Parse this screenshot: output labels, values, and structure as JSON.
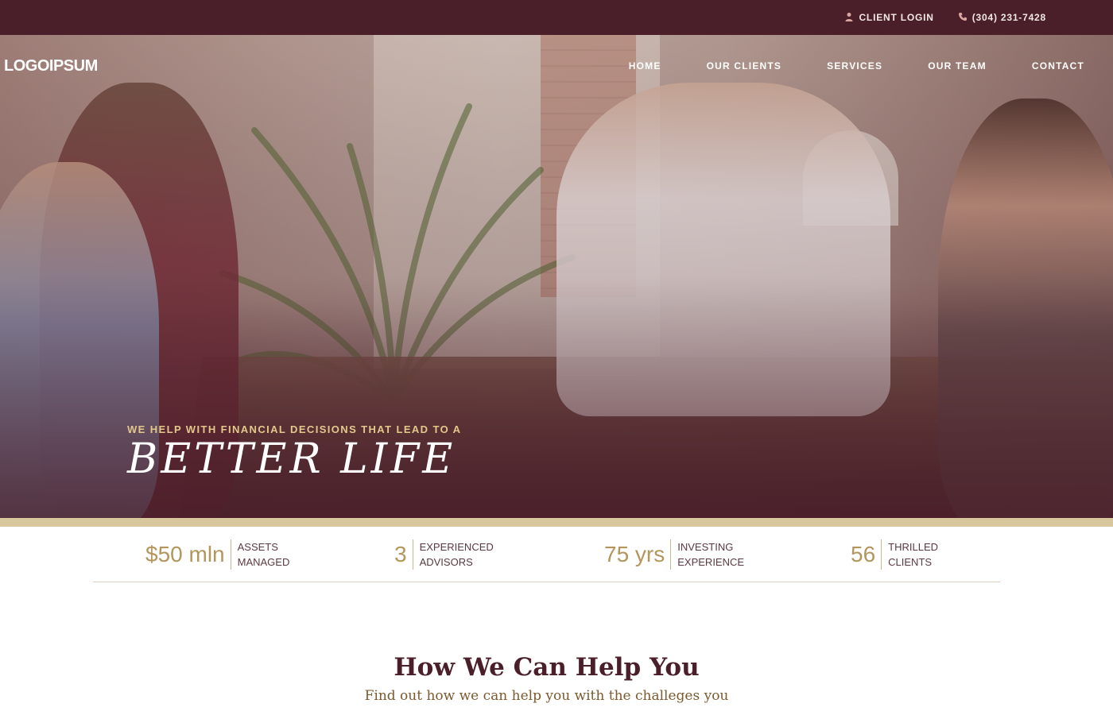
{
  "topbar": {
    "client_login": "CLIENT LOGIN",
    "phone": "(304) 231-7428"
  },
  "logo": "LOGOIPSUM",
  "nav": {
    "items": [
      "HOME",
      "OUR CLIENTS",
      "SERVICES",
      "OUR TEAM",
      "CONTACT"
    ]
  },
  "hero": {
    "tagline": "WE HELP WITH FINANCIAL DECISIONS THAT LEAD TO A",
    "headline": "BETTER LIFE"
  },
  "stats": [
    {
      "value": "$50 mln",
      "label_line1": "ASSETS",
      "label_line2": "MANAGED"
    },
    {
      "value": "3",
      "label_line1": "EXPERIENCED",
      "label_line2": "ADVISORS"
    },
    {
      "value": "75 yrs",
      "label_line1": "INVESTING",
      "label_line2": "EXPERIENCE"
    },
    {
      "value": "56",
      "label_line1": "THRILLED",
      "label_line2": "CLIENTS"
    }
  ],
  "section": {
    "title": "How We Can Help You",
    "subtitle": "Find out how we can help you with the challeges you"
  },
  "colors": {
    "brand_dark": "#4a1f2a",
    "gold": "#b3965c",
    "gold_band": "#d8c79c",
    "accent_text": "#e3c88c"
  },
  "icons": {
    "client_login": "person-icon",
    "phone": "phone-icon"
  }
}
